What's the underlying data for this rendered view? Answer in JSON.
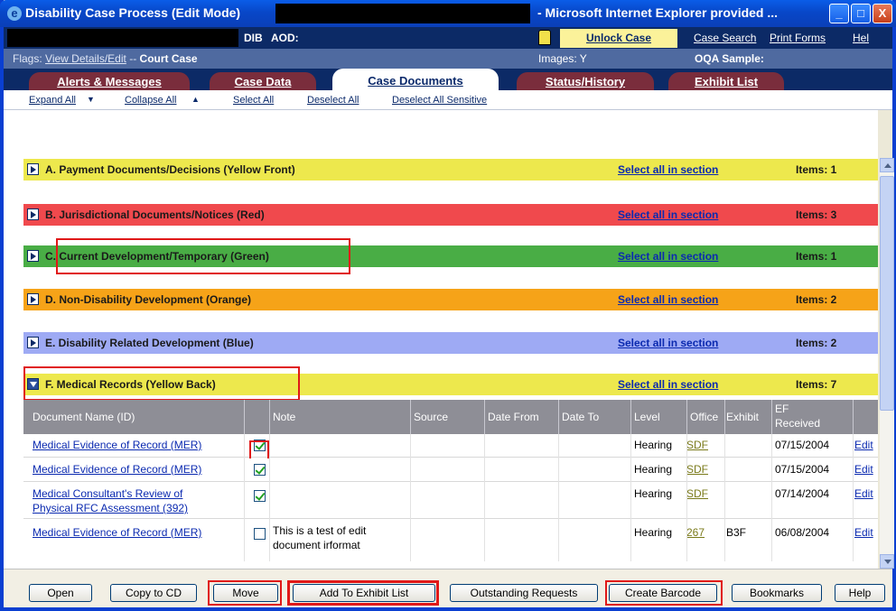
{
  "window": {
    "title": "Disability Case Process (Edit Mode)",
    "title_suffix": "- Microsoft Internet Explorer provided ...",
    "icon": "ie-icon",
    "minimize": "_",
    "maximize": "□",
    "close": "X"
  },
  "header": {
    "dib": "DIB",
    "aod": "AOD:",
    "unlock_case": "Unlock Case",
    "links": [
      "Case Search",
      "Print Forms",
      "Hel"
    ],
    "lock_icon": "lock-icon"
  },
  "flags": {
    "label": "Flags:",
    "view_details": "View Details/Edit",
    "separator": "--",
    "court_case": "Court Case",
    "images": "Images: Y",
    "oqa": "OQA Sample:"
  },
  "tabs": [
    "Alerts & Messages",
    "Case Data",
    "Case Documents",
    "Status/History",
    "Exhibit List"
  ],
  "active_tab": "Case Documents",
  "toolbar": {
    "expand_all": "Expand All",
    "collapse_all": "Collapse All",
    "select_all": "Select All",
    "deselect_all": "Deselect All",
    "deselect_sensitive": "Deselect All Sensitive"
  },
  "sections": [
    {
      "name": "A. Payment Documents/Decisions (Yellow Front)",
      "select": "Select all in section",
      "items": "Items: 1",
      "color": "#ede84d"
    },
    {
      "name": "B. Jurisdictional Documents/Notices (Red)",
      "select": "Select all in section",
      "items": "Items: 3",
      "color": "#f0494d"
    },
    {
      "name": "C. Current Development/Temporary (Green)",
      "select": "Select all in section",
      "items": "Items: 1",
      "color": "#49ad45"
    },
    {
      "name": "D. Non-Disability Development (Orange)",
      "select": "Select all in section",
      "items": "Items: 2",
      "color": "#f6a318"
    },
    {
      "name": "E. Disability Related Development (Blue)",
      "select": "Select all in section",
      "items": "Items: 2",
      "color": "#9eaaf4"
    },
    {
      "name": "F. Medical Records (Yellow Back)",
      "select": "Select all in section",
      "items": "Items: 7",
      "color": "#ede84d"
    }
  ],
  "columns": [
    "Document Name (ID)",
    "Note",
    "Source",
    "Date From",
    "Date To",
    "Level",
    "Office",
    "Exhibit",
    "EF",
    "Received"
  ],
  "rows": [
    {
      "doc": "Medical Evidence of Record (MER)",
      "doc2": "",
      "checked": true,
      "note": "",
      "note2": "",
      "level": "Hearing",
      "office": "SDF",
      "exhibit": "",
      "received": "07/15/2004",
      "action": "Edit"
    },
    {
      "doc": "Medical Evidence of Record (MER)",
      "doc2": "",
      "checked": true,
      "note": "",
      "note2": "",
      "level": "Hearing",
      "office": "SDF",
      "exhibit": "",
      "received": "07/15/2004",
      "action": "Edit"
    },
    {
      "doc": "Medical Consultant's Review of",
      "doc2": "Physical RFC Assessment (392)",
      "checked": true,
      "note": "",
      "note2": "",
      "level": "Hearing",
      "office": "SDF",
      "exhibit": "",
      "received": "07/14/2004",
      "action": "Edit"
    },
    {
      "doc": "Medical Evidence of Record (MER)",
      "doc2": "",
      "checked": false,
      "note": "This is a test of edit",
      "note2": "document irformat",
      "level": "Hearing",
      "office": "267",
      "exhibit": "B3F",
      "received": "06/08/2004",
      "action": "Edit"
    }
  ],
  "buttons": [
    "Open",
    "Copy to CD",
    "Move",
    "Add To Exhibit List",
    "Outstanding Requests",
    "Create Barcode",
    "Bookmarks",
    "Help"
  ]
}
